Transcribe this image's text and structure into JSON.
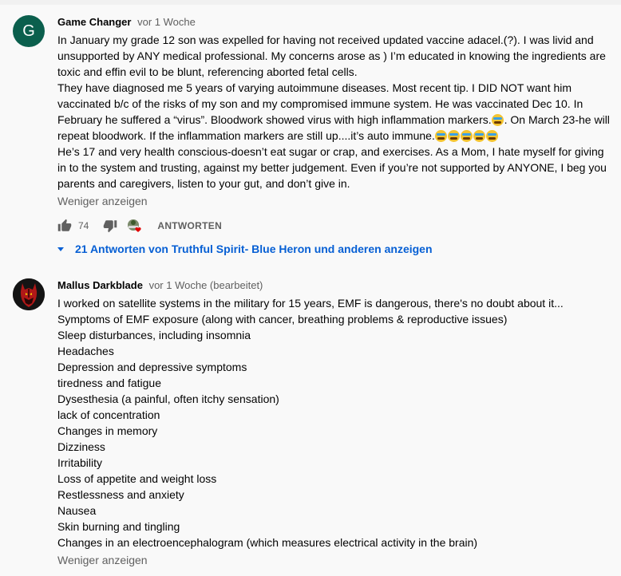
{
  "comment1": {
    "avatar_letter": "G",
    "author": "Game Changer",
    "time": "vor 1 Woche",
    "lines": [
      "In January my grade 12 son was expelled for having not received updated vaccine adacel.(?).  I was livid and",
      "unsupported by ANY medical professional.  My concerns arose as ) I’m educated in knowing the ingredients are",
      "toxic and effin evil to be blunt, referencing aborted fetal cells.",
      "They have diagnosed me 5 years of varying autoimmune diseases.  Most recent tip. I DID NOT want him",
      "vaccinated b/c of the risks of my son and my compromised immune system. He was vaccinated Dec 10.  In",
      "February he suffered a “virus”.  Bloodwork showed virus with high inflammation markers.",
      ". On March 23-he will",
      "repeat bloodwork. If the inflammation markers are still up....it’s auto immune.",
      "He’s 17 and very health conscious-doesn’t eat sugar or crap, and exercises.  As a Mom, I hate myself for giving",
      "in to the system and trusting, against my better judgement.  Even if you’re not supported by ANYONE, I beg you",
      "parents and caregivers, listen to your gut, and don’t give in."
    ],
    "show_less": "Weniger anzeigen",
    "likes": "74",
    "reply_label": "ANTWORTEN",
    "replies_label": "21 Antworten von Truthful Spirit- Blue Heron und anderen anzeigen"
  },
  "comment2": {
    "author": "Mallus Darkblade",
    "time": "vor 1 Woche (bearbeitet)",
    "lines": [
      "I worked on satellite systems in the military for 15 years, EMF is dangerous, there's no doubt about it...",
      "Symptoms of EMF exposure (along with cancer, breathing problems & reproductive issues)",
      "Sleep disturbances, including insomnia",
      "Headaches",
      "Depression and depressive symptoms",
      "tiredness and fatigue",
      "Dysesthesia (a painful, often itchy sensation)",
      "lack of concentration",
      "Changes in memory",
      "Dizziness",
      "Irritability",
      "Loss of appetite and weight loss",
      "Restlessness and anxiety",
      "Nausea",
      "Skin burning and tingling",
      "Changes in an electroencephalogram (which measures electrical activity in the brain)"
    ],
    "show_less": "Weniger anzeigen"
  },
  "colors": {
    "link": "#065fd4",
    "muted": "#606060",
    "avatar_bg": "#0b5f4d"
  },
  "icons": [
    "thumb-up-icon",
    "thumb-down-icon",
    "creator-heart-icon",
    "expand-triangle-icon"
  ]
}
